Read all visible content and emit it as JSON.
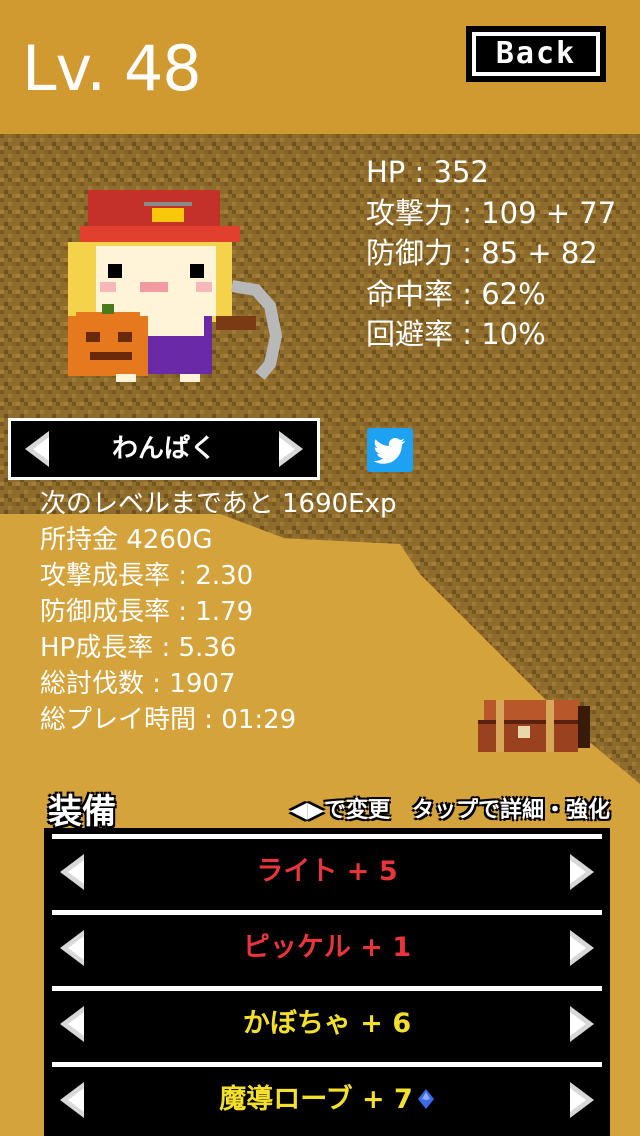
{
  "header": {
    "level": "Lv. 48",
    "back_label": "Back"
  },
  "stats": {
    "hp": "HP : 352",
    "attack": "攻撃力 : 109 + 77",
    "defense": "防御力 : 85 + 82",
    "accuracy": "命中率 : 62%",
    "evasion": "回避率 : 10%"
  },
  "character": {
    "name": "わんぱく"
  },
  "info": {
    "next_level": "次のレベルまであと 1690Exp",
    "money": "所持金 4260G",
    "attack_growth": "攻撃成長率 : 2.30",
    "defense_growth": "防御成長率 : 1.79",
    "hp_growth": "HP成長率 : 5.36",
    "total_kills": "総討伐数 : 1907",
    "play_time": "総プレイ時間 : 01:29"
  },
  "equipment": {
    "title": "装備",
    "hint": "◀▶で変更　タップで詳細・強化",
    "items": [
      {
        "label": "ライト + 5",
        "color": "#e8343a"
      },
      {
        "label": "ピッケル + 1",
        "color": "#e8343a"
      },
      {
        "label": "かぼちゃ + 6",
        "color": "#f4e02a"
      },
      {
        "label": "魔導ローブ + 7",
        "color": "#f4e02a"
      }
    ]
  },
  "colors": {
    "header_bg": "#d19a30",
    "dirt_dark": "#8a6a2a",
    "sand": "#d4a33c",
    "twitter": "#1da1f2"
  },
  "icons": {
    "twitter": "twitter-bird-icon",
    "chest": "treasure-chest-icon",
    "gem": "blue-gem-icon"
  }
}
